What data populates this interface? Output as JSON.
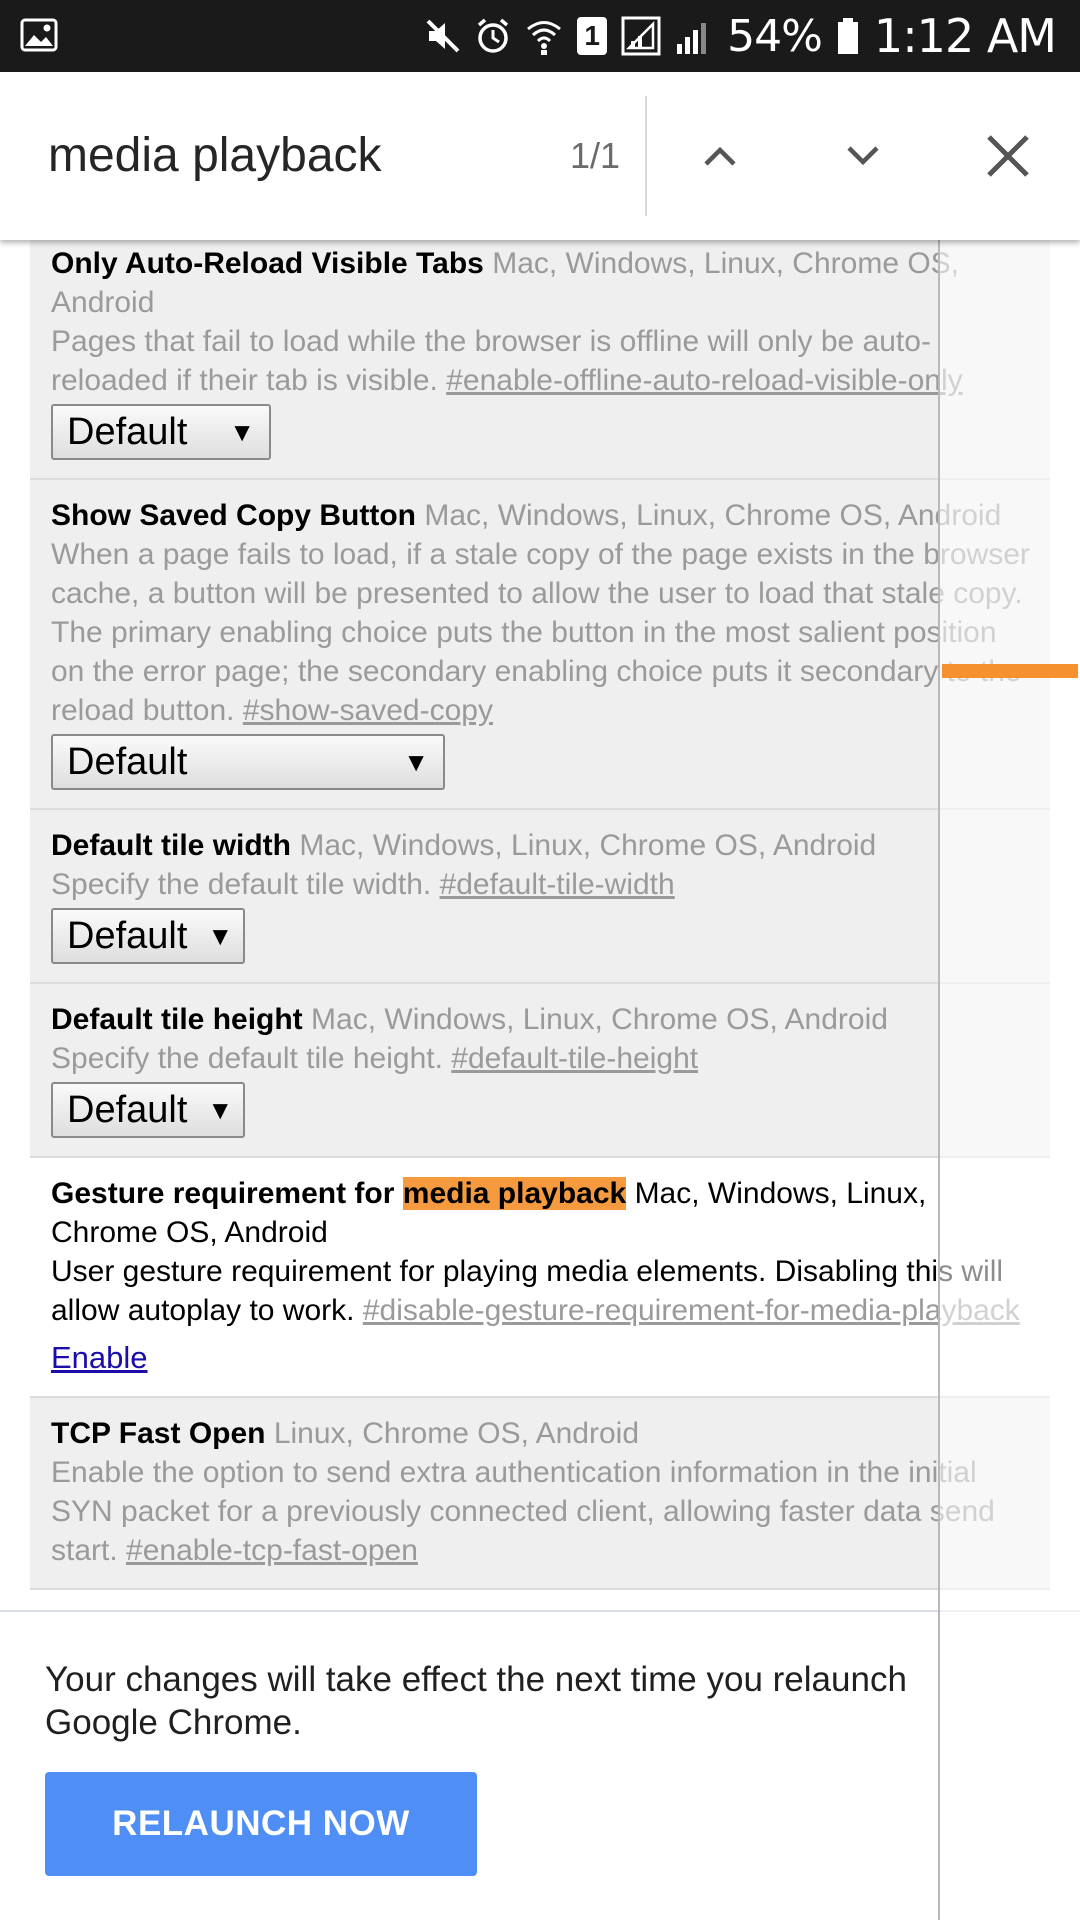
{
  "status_bar": {
    "battery": "54%",
    "time": "1:12 AM",
    "sim_slot": "1",
    "icons": [
      "gallery-icon",
      "mute-icon",
      "alarm-icon",
      "wifi-icon",
      "sim-icon",
      "signal-icon",
      "signal-icon",
      "battery-icon"
    ]
  },
  "find_bar": {
    "query": "media playback",
    "match_count": "1/1",
    "icons": [
      "chevron-up-icon",
      "chevron-down-icon",
      "close-icon"
    ]
  },
  "flags": [
    {
      "name": "Only Auto-Reload Visible Tabs",
      "platforms": "Mac, Windows, Linux, Chrome OS, Android",
      "description": "Pages that fail to load while the browser is offline will only be auto-reloaded if their tab is visible.",
      "link": "#enable-offline-auto-reload-visible-only",
      "control": "Default"
    },
    {
      "name": "Show Saved Copy Button",
      "platforms": "Mac, Windows, Linux, Chrome OS, Android",
      "description": "When a page fails to load, if a stale copy of the page exists in the browser cache, a button will be presented to allow the user to load that stale copy. The primary enabling choice puts the button in the most salient position on the error page; the secondary enabling choice puts it secondary to the reload button.",
      "link": "#show-saved-copy",
      "control": "Default"
    },
    {
      "name": "Default tile width",
      "platforms": "Mac, Windows, Linux, Chrome OS, Android",
      "description": "Specify the default tile width.",
      "link": "#default-tile-width",
      "control": "Default"
    },
    {
      "name": "Default tile height",
      "platforms": "Mac, Windows, Linux, Chrome OS, Android",
      "description": "Specify the default tile height.",
      "link": "#default-tile-height",
      "control": "Default"
    },
    {
      "name_prefix": "Gesture requirement for ",
      "name_highlight": "media playback",
      "platforms": "Mac, Windows, Linux, Chrome OS, Android",
      "description": "User gesture requirement for playing media elements. Disabling this will allow autoplay to work.",
      "link": "#disable-gesture-requirement-for-media-playback",
      "control": "Enable"
    },
    {
      "name": "TCP Fast Open",
      "platforms": "Linux, Chrome OS, Android",
      "description": "Enable the option to send extra authentication information in the initial SYN packet for a previously connected client, allowing faster data send start.",
      "link": "#enable-tcp-fast-open"
    }
  ],
  "relaunch": {
    "message": "Your changes will take effect the next time you relaunch Google Chrome.",
    "button": "RELAUNCH NOW"
  },
  "colors": {
    "find_highlight": "#f59a3f",
    "relaunch_button": "#4f8ff5",
    "enable_link": "#1a0dab"
  }
}
